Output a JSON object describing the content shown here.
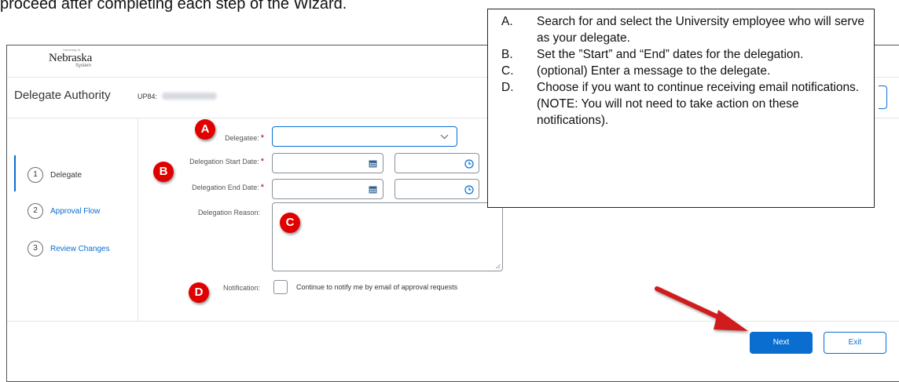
{
  "doc_header": "proceed after completing each step of the Wizard.",
  "logo": {
    "top": "University of",
    "name": "Nebraska",
    "sub": "System"
  },
  "page": {
    "title": "Delegate Authority",
    "code": "UP84:"
  },
  "steps": [
    {
      "num": "1",
      "label": "Delegate",
      "active": true
    },
    {
      "num": "2",
      "label": "Approval Flow",
      "active": false
    },
    {
      "num": "3",
      "label": "Review Changes",
      "active": false
    }
  ],
  "form": {
    "delegatee_label": "Delegatee:",
    "start_label": "Delegation Start Date:",
    "end_label": "Delegation End Date:",
    "reason_label": "Delegation Reason:",
    "notification_label": "Notification:",
    "notification_text": "Continue to notify me by email of approval requests",
    "required_mark": "*"
  },
  "markers": {
    "a": "A",
    "b": "B",
    "c": "C",
    "d": "D"
  },
  "buttons": {
    "next": "Next",
    "exit": "Exit"
  },
  "callout": {
    "items": [
      {
        "letter": "A.",
        "text": "Search for and select the University employee who will serve as your delegate."
      },
      {
        "letter": "B.",
        "text": "Set the ”Start” and “End” dates for the delegation."
      },
      {
        "letter": "C.",
        "text": "(optional) Enter a message to the delegate."
      },
      {
        "letter": "D.",
        "text": "Choose if you want to continue receiving email notifications. (NOTE: You will not need to take action on these notifications)."
      }
    ]
  },
  "colors": {
    "accent": "#0a6ed1",
    "marker": "#e00000",
    "required": "#bb0000",
    "arrow": "#d01a1a"
  },
  "icons": {
    "dropdown": "chevron-down-icon",
    "calendar": "calendar-icon",
    "time": "clock-icon"
  }
}
